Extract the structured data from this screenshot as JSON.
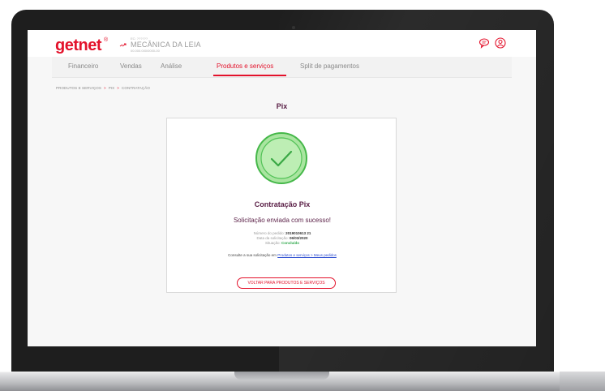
{
  "header": {
    "logo": "getnet",
    "logo_mark": "®",
    "merchant_ec": "EC: ??????",
    "merchant_name": "MECÂNICA DA LEIA",
    "merchant_cnpj": "00.000.000/0000-00",
    "icons": [
      "link-icon",
      "chat-icon",
      "user-icon"
    ]
  },
  "nav": {
    "items": [
      {
        "label": "Financeiro"
      },
      {
        "label": "Vendas"
      },
      {
        "label": "Análise"
      },
      {
        "label": "Produtos e serviços",
        "active": true
      },
      {
        "label": "Split de pagamentos"
      }
    ]
  },
  "breadcrumb": {
    "items": [
      "PRODUTOS E SERVIÇOS",
      "PIX",
      "CONTRATAÇÃO"
    ],
    "separator": ">"
  },
  "page": {
    "title": "Pix"
  },
  "card": {
    "title": "Contratação Pix",
    "message": "Solicitação enviada com sucesso!",
    "order_label": "Número do pedido:",
    "order_value": "2019010613 21",
    "date_label": "Data da solicitação:",
    "date_value": "06/03/2020",
    "status_label": "Situação:",
    "status_value": "Concluído",
    "consult_text": "Consulte a sua solicitação em",
    "consult_link": "Produtos e serviços > Meus pedidos",
    "back_button": "VOLTAR PARA PRODUTOS E SERVIÇOS"
  },
  "colors": {
    "brand_red": "#e3122b",
    "title_purple": "#5a1f46",
    "success_green": "#2ea84a",
    "link_blue": "#2a4bd0"
  }
}
